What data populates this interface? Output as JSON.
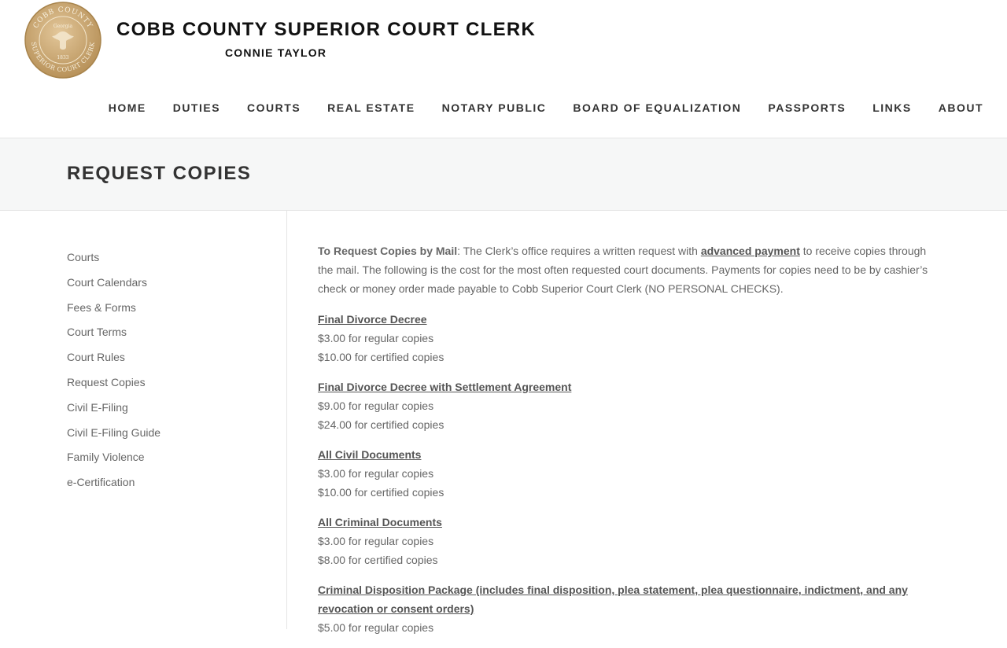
{
  "header": {
    "title": "COBB COUNTY SUPERIOR COURT CLERK",
    "subtitle": "CONNIE TAYLOR",
    "seal": {
      "top_text": "COBB COUNTY",
      "bottom_text": "SUPERIOR COURT CLERK",
      "state": "Georgia",
      "year": "1833"
    }
  },
  "nav": {
    "items": [
      "HOME",
      "DUTIES",
      "COURTS",
      "REAL ESTATE",
      "NOTARY PUBLIC",
      "BOARD OF EQUALIZATION",
      "PASSPORTS",
      "LINKS",
      "ABOUT"
    ]
  },
  "page": {
    "title": "REQUEST COPIES"
  },
  "sidebar": {
    "items": [
      "Courts",
      "Court Calendars",
      "Fees & Forms",
      "Court Terms",
      "Court Rules",
      "Request Copies",
      "Civil E-Filing",
      "Civil E-Filing Guide",
      "Family Violence",
      "e-Certification"
    ]
  },
  "content": {
    "intro": {
      "label": "To Request Copies by Mail",
      "text1": ": The Clerk’s office requires a written request with ",
      "link": "advanced payment",
      "text2": " to receive copies through the mail. The following is the cost for the most often requested court documents. Payments for copies need to be by cashier’s check or money order made payable to Cobb Superior Court Clerk (NO PERSONAL CHECKS)."
    },
    "documents": [
      {
        "title": "Final Divorce Decree",
        "lines": [
          "$3.00 for regular copies",
          "$10.00 for certified copies"
        ]
      },
      {
        "title": "Final Divorce Decree with Settlement Agreement",
        "lines": [
          "$9.00 for regular copies",
          "$24.00 for certified copies"
        ]
      },
      {
        "title": "All Civil Documents",
        "lines": [
          "$3.00 for regular copies",
          "$10.00 for certified copies"
        ]
      },
      {
        "title": "All Criminal Documents",
        "lines": [
          "$3.00 for regular copies",
          "$8.00 for certified copies"
        ]
      },
      {
        "title": "Criminal Disposition Package (includes final disposition, plea statement, plea questionnaire, indictment, and any revocation or consent orders)",
        "lines": [
          "$5.00 for regular copies"
        ]
      }
    ]
  },
  "colors": {
    "title": "#111111",
    "nav": "#333333",
    "text": "#666666",
    "band": "#f6f7f7",
    "seal_gold": "#c9a66b"
  }
}
